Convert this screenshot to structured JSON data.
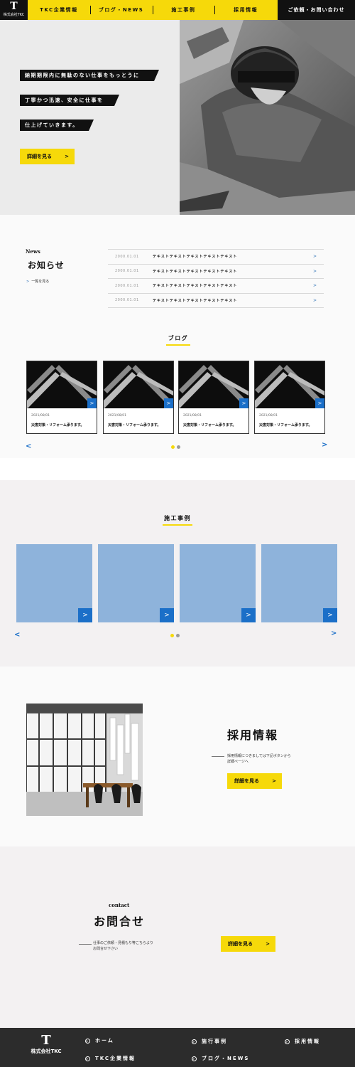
{
  "header": {
    "logo_mark": "T",
    "logo_name": "株式会社TKC",
    "nav": [
      "TKC企業情報",
      "ブログ・NEWS",
      "施工事例",
      "採用情報"
    ],
    "contact": "ご依頼・お問い合わせ"
  },
  "hero": {
    "lines": [
      "納期期限内に無駄のない仕事をもっとうに",
      "丁寧かつ迅速、安全に仕事を",
      "仕上げていきます。"
    ],
    "button": "詳細を見る",
    "arrow": ">"
  },
  "news": {
    "label": "News",
    "title": "お知らせ",
    "more": "一覧を見る",
    "items": [
      {
        "date": "2000.01.01",
        "text": "テキストテキストテキストテキストテキスト"
      },
      {
        "date": "2000.01.01",
        "text": "テキストテキストテキストテキストテキスト"
      },
      {
        "date": "2000.01.01",
        "text": "テキストテキストテキストテキストテキスト"
      },
      {
        "date": "2000.01.01",
        "text": "テキストテキストテキストテキストテキスト"
      }
    ]
  },
  "blog": {
    "heading": "ブログ",
    "cards": [
      {
        "date": "2021/08/01",
        "title": "災害対策・リフォーム承ります。"
      },
      {
        "date": "2021/08/01",
        "title": "災害対策・リフォーム承ります。"
      },
      {
        "date": "2021/08/01",
        "title": "災害対策・リフォーム承ります。"
      },
      {
        "date": "2021/08/01",
        "title": "災害対策・リフォーム承ります。"
      }
    ],
    "prev": "<",
    "next": ">"
  },
  "works": {
    "heading": "施工事例",
    "prev": "<",
    "next": ">"
  },
  "recruit": {
    "title": "採用情報",
    "desc_line1": "採用情報につきましては下記ボタンから",
    "desc_line2": "詳細ページへ",
    "button": "詳細を見る"
  },
  "contact": {
    "label": "contact",
    "title": "お問合せ",
    "desc_line1": "仕事のご依頼・見積もり等こちらより",
    "desc_line2": "お問合せ下さい",
    "button": "詳細を見る"
  },
  "footer": {
    "logo_mark": "T",
    "logo_name": "株式会社TKC",
    "links": [
      "ホーム",
      "施行事例",
      "採用情報",
      "TKC企業情報",
      "ブログ・NEWS"
    ]
  },
  "colors": {
    "accent_yellow": "#f6d90a",
    "accent_blue": "#1b6fc8",
    "placeholder_blue": "#8eb3db"
  }
}
